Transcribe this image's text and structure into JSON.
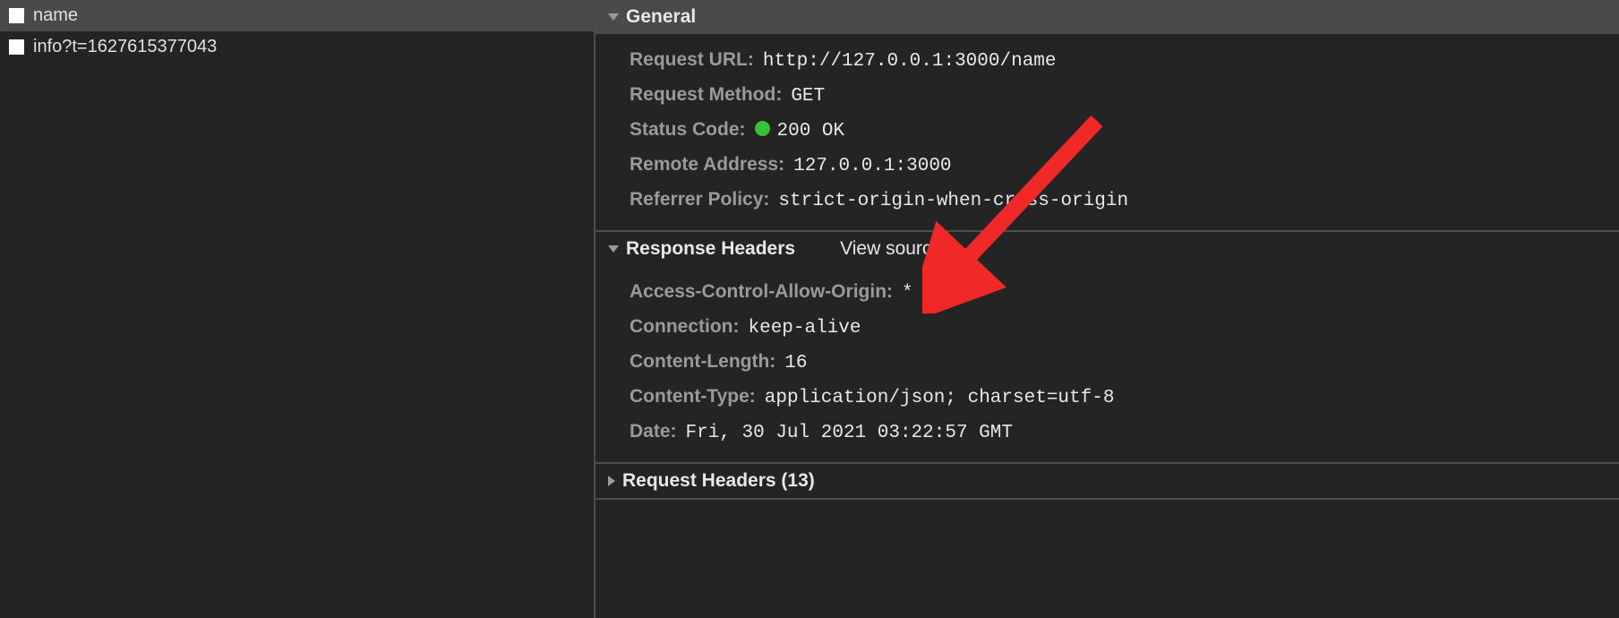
{
  "requests": [
    {
      "name": "name"
    },
    {
      "name": "info?t=1627615377043"
    }
  ],
  "sections": {
    "general": {
      "title": "General",
      "rows": [
        {
          "label": "Request URL:",
          "value": "http://127.0.0.1:3000/name"
        },
        {
          "label": "Request Method:",
          "value": "GET"
        },
        {
          "label": "Status Code:",
          "value": "200 OK",
          "status": true
        },
        {
          "label": "Remote Address:",
          "value": "127.0.0.1:3000"
        },
        {
          "label": "Referrer Policy:",
          "value": "strict-origin-when-cross-origin"
        }
      ]
    },
    "response": {
      "title": "Response Headers",
      "view_source": "View source",
      "rows": [
        {
          "label": "Access-Control-Allow-Origin:",
          "value": "*"
        },
        {
          "label": "Connection:",
          "value": "keep-alive"
        },
        {
          "label": "Content-Length:",
          "value": "16"
        },
        {
          "label": "Content-Type:",
          "value": "application/json; charset=utf-8"
        },
        {
          "label": "Date:",
          "value": "Fri, 30 Jul 2021 03:22:57 GMT"
        }
      ]
    },
    "request": {
      "title": "Request Headers (13)"
    }
  }
}
